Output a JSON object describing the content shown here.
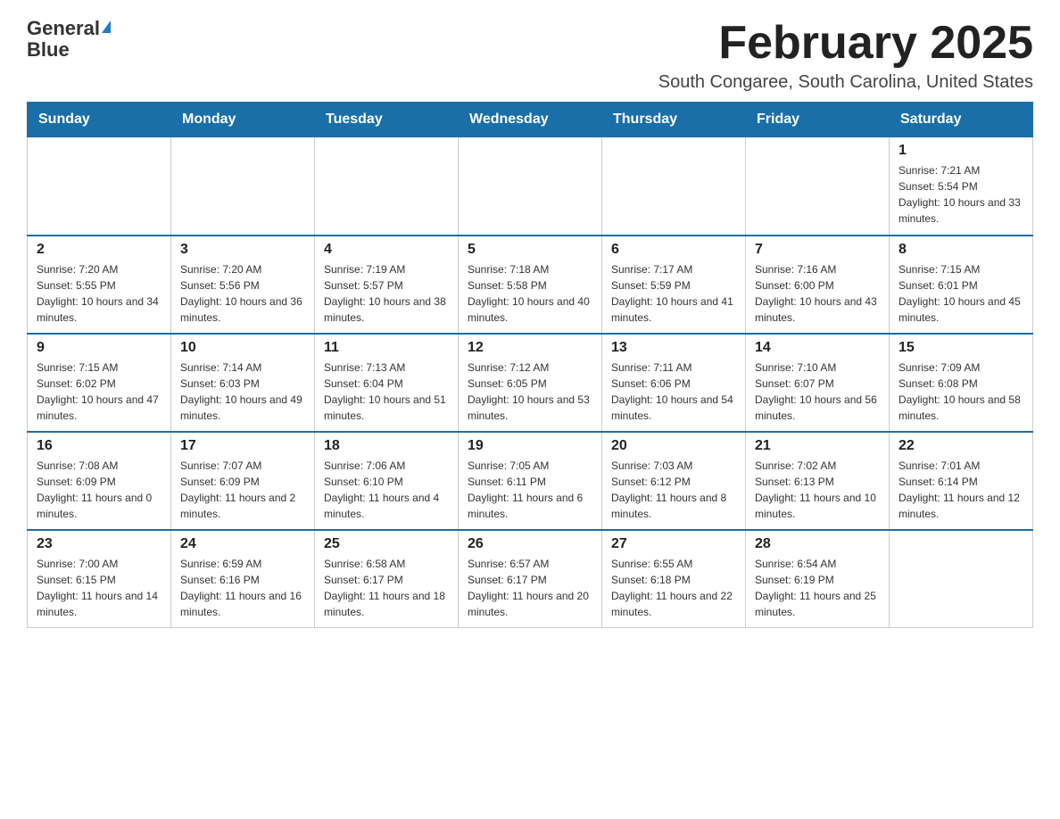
{
  "header": {
    "logo_line1": "General",
    "logo_line2": "Blue",
    "month_title": "February 2025",
    "location": "South Congaree, South Carolina, United States"
  },
  "days_of_week": [
    "Sunday",
    "Monday",
    "Tuesday",
    "Wednesday",
    "Thursday",
    "Friday",
    "Saturday"
  ],
  "weeks": [
    [
      {
        "day": "",
        "sunrise": "",
        "sunset": "",
        "daylight": ""
      },
      {
        "day": "",
        "sunrise": "",
        "sunset": "",
        "daylight": ""
      },
      {
        "day": "",
        "sunrise": "",
        "sunset": "",
        "daylight": ""
      },
      {
        "day": "",
        "sunrise": "",
        "sunset": "",
        "daylight": ""
      },
      {
        "day": "",
        "sunrise": "",
        "sunset": "",
        "daylight": ""
      },
      {
        "day": "",
        "sunrise": "",
        "sunset": "",
        "daylight": ""
      },
      {
        "day": "1",
        "sunrise": "Sunrise: 7:21 AM",
        "sunset": "Sunset: 5:54 PM",
        "daylight": "Daylight: 10 hours and 33 minutes."
      }
    ],
    [
      {
        "day": "2",
        "sunrise": "Sunrise: 7:20 AM",
        "sunset": "Sunset: 5:55 PM",
        "daylight": "Daylight: 10 hours and 34 minutes."
      },
      {
        "day": "3",
        "sunrise": "Sunrise: 7:20 AM",
        "sunset": "Sunset: 5:56 PM",
        "daylight": "Daylight: 10 hours and 36 minutes."
      },
      {
        "day": "4",
        "sunrise": "Sunrise: 7:19 AM",
        "sunset": "Sunset: 5:57 PM",
        "daylight": "Daylight: 10 hours and 38 minutes."
      },
      {
        "day": "5",
        "sunrise": "Sunrise: 7:18 AM",
        "sunset": "Sunset: 5:58 PM",
        "daylight": "Daylight: 10 hours and 40 minutes."
      },
      {
        "day": "6",
        "sunrise": "Sunrise: 7:17 AM",
        "sunset": "Sunset: 5:59 PM",
        "daylight": "Daylight: 10 hours and 41 minutes."
      },
      {
        "day": "7",
        "sunrise": "Sunrise: 7:16 AM",
        "sunset": "Sunset: 6:00 PM",
        "daylight": "Daylight: 10 hours and 43 minutes."
      },
      {
        "day": "8",
        "sunrise": "Sunrise: 7:15 AM",
        "sunset": "Sunset: 6:01 PM",
        "daylight": "Daylight: 10 hours and 45 minutes."
      }
    ],
    [
      {
        "day": "9",
        "sunrise": "Sunrise: 7:15 AM",
        "sunset": "Sunset: 6:02 PM",
        "daylight": "Daylight: 10 hours and 47 minutes."
      },
      {
        "day": "10",
        "sunrise": "Sunrise: 7:14 AM",
        "sunset": "Sunset: 6:03 PM",
        "daylight": "Daylight: 10 hours and 49 minutes."
      },
      {
        "day": "11",
        "sunrise": "Sunrise: 7:13 AM",
        "sunset": "Sunset: 6:04 PM",
        "daylight": "Daylight: 10 hours and 51 minutes."
      },
      {
        "day": "12",
        "sunrise": "Sunrise: 7:12 AM",
        "sunset": "Sunset: 6:05 PM",
        "daylight": "Daylight: 10 hours and 53 minutes."
      },
      {
        "day": "13",
        "sunrise": "Sunrise: 7:11 AM",
        "sunset": "Sunset: 6:06 PM",
        "daylight": "Daylight: 10 hours and 54 minutes."
      },
      {
        "day": "14",
        "sunrise": "Sunrise: 7:10 AM",
        "sunset": "Sunset: 6:07 PM",
        "daylight": "Daylight: 10 hours and 56 minutes."
      },
      {
        "day": "15",
        "sunrise": "Sunrise: 7:09 AM",
        "sunset": "Sunset: 6:08 PM",
        "daylight": "Daylight: 10 hours and 58 minutes."
      }
    ],
    [
      {
        "day": "16",
        "sunrise": "Sunrise: 7:08 AM",
        "sunset": "Sunset: 6:09 PM",
        "daylight": "Daylight: 11 hours and 0 minutes."
      },
      {
        "day": "17",
        "sunrise": "Sunrise: 7:07 AM",
        "sunset": "Sunset: 6:09 PM",
        "daylight": "Daylight: 11 hours and 2 minutes."
      },
      {
        "day": "18",
        "sunrise": "Sunrise: 7:06 AM",
        "sunset": "Sunset: 6:10 PM",
        "daylight": "Daylight: 11 hours and 4 minutes."
      },
      {
        "day": "19",
        "sunrise": "Sunrise: 7:05 AM",
        "sunset": "Sunset: 6:11 PM",
        "daylight": "Daylight: 11 hours and 6 minutes."
      },
      {
        "day": "20",
        "sunrise": "Sunrise: 7:03 AM",
        "sunset": "Sunset: 6:12 PM",
        "daylight": "Daylight: 11 hours and 8 minutes."
      },
      {
        "day": "21",
        "sunrise": "Sunrise: 7:02 AM",
        "sunset": "Sunset: 6:13 PM",
        "daylight": "Daylight: 11 hours and 10 minutes."
      },
      {
        "day": "22",
        "sunrise": "Sunrise: 7:01 AM",
        "sunset": "Sunset: 6:14 PM",
        "daylight": "Daylight: 11 hours and 12 minutes."
      }
    ],
    [
      {
        "day": "23",
        "sunrise": "Sunrise: 7:00 AM",
        "sunset": "Sunset: 6:15 PM",
        "daylight": "Daylight: 11 hours and 14 minutes."
      },
      {
        "day": "24",
        "sunrise": "Sunrise: 6:59 AM",
        "sunset": "Sunset: 6:16 PM",
        "daylight": "Daylight: 11 hours and 16 minutes."
      },
      {
        "day": "25",
        "sunrise": "Sunrise: 6:58 AM",
        "sunset": "Sunset: 6:17 PM",
        "daylight": "Daylight: 11 hours and 18 minutes."
      },
      {
        "day": "26",
        "sunrise": "Sunrise: 6:57 AM",
        "sunset": "Sunset: 6:17 PM",
        "daylight": "Daylight: 11 hours and 20 minutes."
      },
      {
        "day": "27",
        "sunrise": "Sunrise: 6:55 AM",
        "sunset": "Sunset: 6:18 PM",
        "daylight": "Daylight: 11 hours and 22 minutes."
      },
      {
        "day": "28",
        "sunrise": "Sunrise: 6:54 AM",
        "sunset": "Sunset: 6:19 PM",
        "daylight": "Daylight: 11 hours and 25 minutes."
      },
      {
        "day": "",
        "sunrise": "",
        "sunset": "",
        "daylight": ""
      }
    ]
  ]
}
